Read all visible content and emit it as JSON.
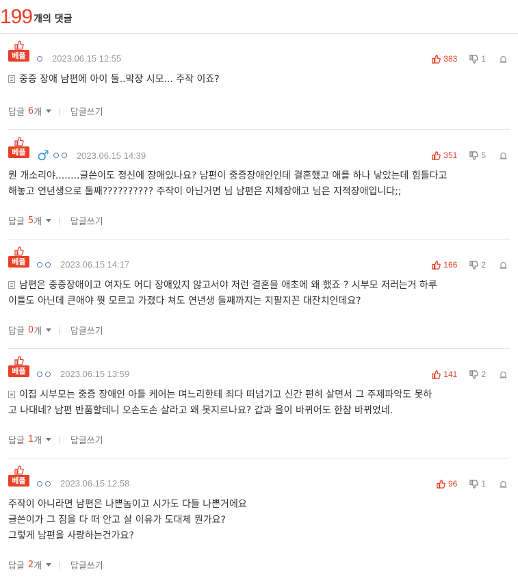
{
  "header": {
    "count": "199",
    "label": "개의 댓글"
  },
  "comments": [
    {
      "badge": "베플",
      "gender": "",
      "circles": 1,
      "date": "2023.06.15 12:55",
      "up": "383",
      "down": "1",
      "doc_icon": true,
      "lines": [
        "중증 장애 남편에 아이 둘..막장 시모... 주작 이죠?"
      ],
      "reply_label": "답글",
      "reply_count": "6",
      "reply_unit": "개",
      "write_label": "답글쓰기"
    },
    {
      "badge": "베플",
      "gender": "♂",
      "circles": 2,
      "date": "2023.06.15 14:39",
      "up": "351",
      "down": "5",
      "doc_icon": false,
      "lines": [
        "뭔 개소리야........글쓴이도 정신에 장애있나요? 남편이 중증장애인인데 결혼했고 애를 하나 낳았는데 힘들다고",
        "해놓고 연년생으로 둘째?????????? 주작이 아닌거면 님 남편은 지체장애고 님은 지적장애입니다;;"
      ],
      "reply_label": "답글",
      "reply_count": "5",
      "reply_unit": "개",
      "write_label": "답글쓰기"
    },
    {
      "badge": "베플",
      "gender": "",
      "circles": 2,
      "date": "2023.06.15 14:17",
      "up": "166",
      "down": "2",
      "doc_icon": true,
      "lines": [
        "남편은 중증장애이고 여자도 어디 장애있지 않고서야 저런 결혼을 애초에 왜 했죠 ? 시부모 저러는거 하루",
        "이틀도 아닌데 큰애야 뭣 모르고 가졌다 쳐도 연년생 둘째까지는 지팔지꼰 대잔치인데요?"
      ],
      "reply_label": "답글",
      "reply_count": "0",
      "reply_unit": "개",
      "write_label": "답글쓰기"
    },
    {
      "badge": "베플",
      "gender": "",
      "circles": 2,
      "date": "2023.06.15 13:59",
      "up": "141",
      "down": "2",
      "doc_icon": true,
      "lines": [
        "이집 시부모는 중증 장애인 아들 케어는 며느리한테 죄다 떠넘기고 신간 편히 살면서 그 주제파악도 못하",
        "고 나대네? 남편 반품할테니 오손도손 살라고 왜 못지르나요? 갑과 을이 바뀌어도 한참 바뀌었네."
      ],
      "reply_label": "답글",
      "reply_count": "1",
      "reply_unit": "개",
      "write_label": "답글쓰기"
    },
    {
      "badge": "베플",
      "gender": "",
      "circles": 2,
      "date": "2023.06.15 12:58",
      "up": "96",
      "down": "1",
      "doc_icon": false,
      "lines": [
        "주작이 아니라면 남편은 나쁜놈이고 시가도 다들 나쁜거에요",
        "글쓴이가 그 짐을 다 떠 안고 살 이유가 도대체 뭔가요?",
        "그렇게 남편을 사랑하는건가요?"
      ],
      "reply_label": "답글",
      "reply_count": "2",
      "reply_unit": "개",
      "write_label": "답글쓰기"
    }
  ],
  "colors": {
    "accent": "#e8402a",
    "muted": "#999999",
    "circle": "#5a7fb5",
    "gender": "#3b9ad8"
  },
  "icons": {
    "badge": "thumbs-up-icon",
    "up": "thumbs-up-icon",
    "down": "thumbs-down-icon",
    "report": "report-icon",
    "doc": "document-icon"
  }
}
